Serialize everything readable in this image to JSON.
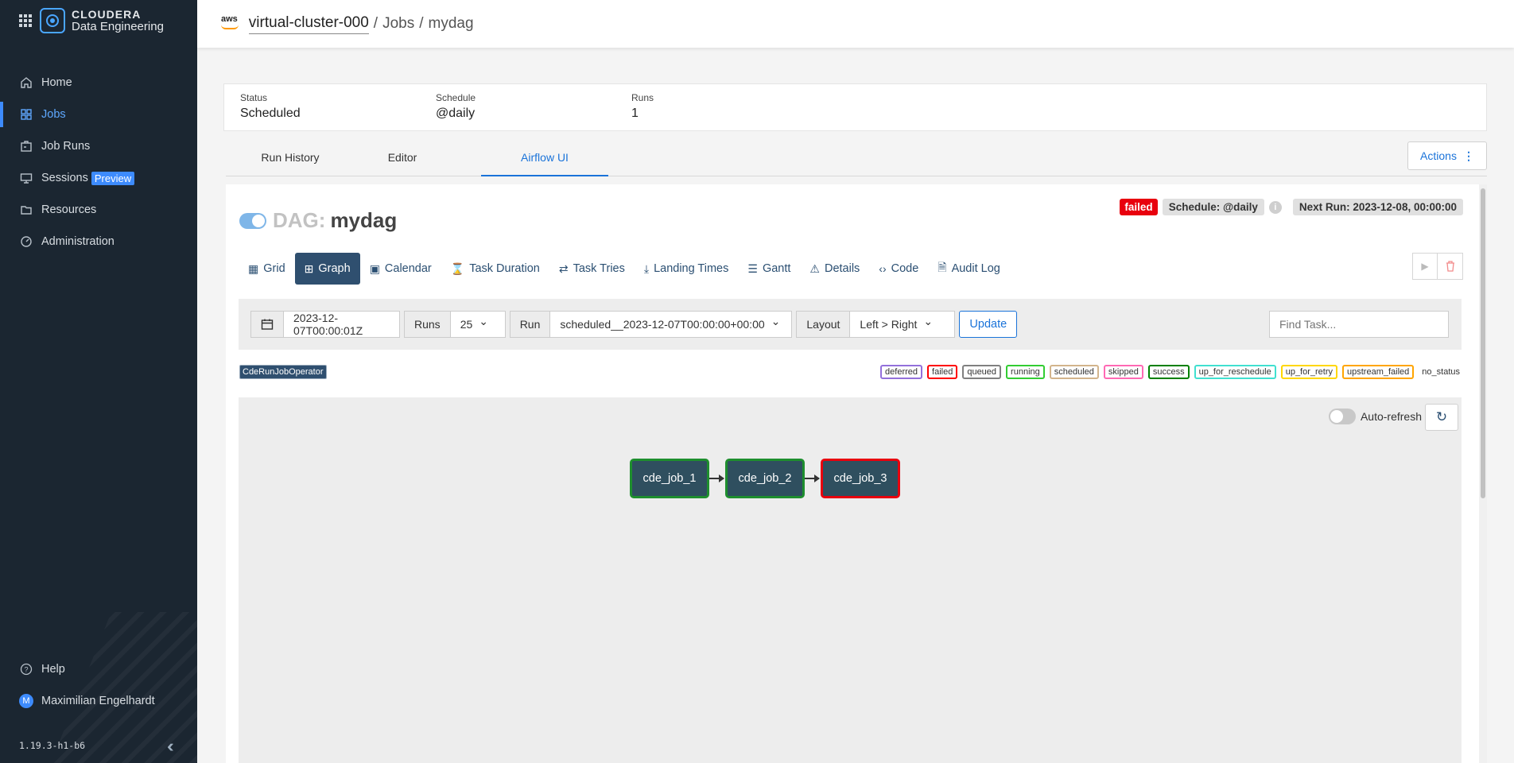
{
  "sidebar": {
    "brand_line1": "CLOUDERA",
    "brand_line2": "Data Engineering",
    "items": [
      {
        "label": "Home",
        "icon": "home-icon"
      },
      {
        "label": "Jobs",
        "icon": "jobs-grid-icon"
      },
      {
        "label": "Job Runs",
        "icon": "job-runs-icon"
      },
      {
        "label": "Sessions",
        "icon": "monitor-icon",
        "badge": "Preview"
      },
      {
        "label": "Resources",
        "icon": "folder-icon"
      },
      {
        "label": "Administration",
        "icon": "gauge-icon"
      }
    ],
    "help_label": "Help",
    "user_initial": "M",
    "user_name": "Maximilian Engelhardt",
    "version": "1.19.3-h1-b6"
  },
  "topbar": {
    "cloud": "aws",
    "cluster": "virtual-cluster-000",
    "sep": "/",
    "jobs": "Jobs",
    "job": "mydag"
  },
  "summary": {
    "status_label": "Status",
    "status_value": "Scheduled",
    "schedule_label": "Schedule",
    "schedule_value": "@daily",
    "runs_label": "Runs",
    "runs_value": "1"
  },
  "tabs": {
    "items": [
      "Run History",
      "Editor",
      "Airflow UI"
    ],
    "active": "Airflow UI",
    "actions_label": "Actions"
  },
  "dag": {
    "prefix": "DAG:",
    "name": "mydag",
    "paused": false,
    "state_badge": "failed",
    "schedule_badge": "Schedule: @daily",
    "next_run": "Next Run: 2023-12-08, 00:00:00",
    "views": [
      "Grid",
      "Graph",
      "Calendar",
      "Task Duration",
      "Task Tries",
      "Landing Times",
      "Gantt",
      "Details",
      "Code",
      "Audit Log"
    ],
    "active_view": "Graph"
  },
  "filters": {
    "base_date": "2023-12-07T00:00:01Z",
    "runs_label": "Runs",
    "runs_value": "25",
    "run_label": "Run",
    "run_value": "scheduled__2023-12-07T00:00:00+00:00",
    "layout_label": "Layout",
    "layout_value": "Left > Right",
    "update_label": "Update",
    "find_placeholder": "Find Task..."
  },
  "operator": "CdeRunJobOperator",
  "legend": [
    {
      "label": "deferred",
      "color": "#9370db"
    },
    {
      "label": "failed",
      "color": "#ff0000"
    },
    {
      "label": "queued",
      "color": "#808080"
    },
    {
      "label": "running",
      "color": "#32cd32"
    },
    {
      "label": "scheduled",
      "color": "#d2b48c"
    },
    {
      "label": "skipped",
      "color": "#ff69b4"
    },
    {
      "label": "success",
      "color": "#008000"
    },
    {
      "label": "up_for_reschedule",
      "color": "#40e0d0"
    },
    {
      "label": "up_for_retry",
      "color": "#ffd700"
    },
    {
      "label": "upstream_failed",
      "color": "#ffa500"
    },
    {
      "label": "no_status",
      "color": null
    }
  ],
  "graph": {
    "autorefresh_label": "Auto-refresh",
    "nodes": [
      {
        "label": "cde_job_1",
        "state": "success"
      },
      {
        "label": "cde_job_2",
        "state": "success"
      },
      {
        "label": "cde_job_3",
        "state": "failed"
      }
    ]
  }
}
